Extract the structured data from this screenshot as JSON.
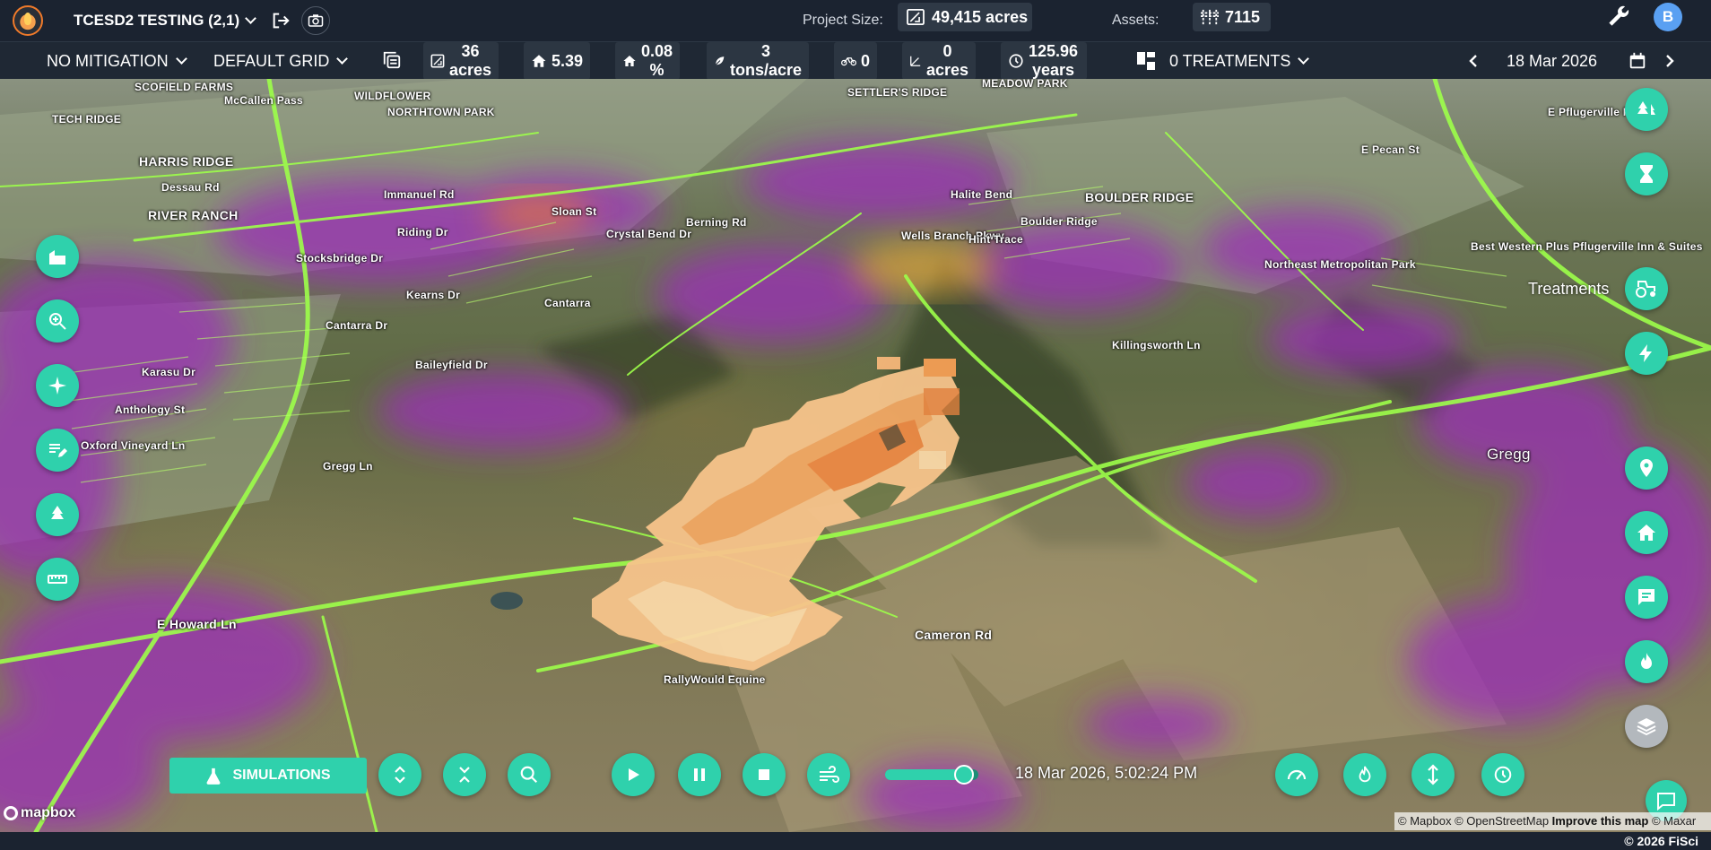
{
  "header": {
    "project_name": "TCESD2 TESTING (2,1)",
    "project_size_label": "Project Size:",
    "project_size_value": "49,415 acres",
    "assets_label": "Assets:",
    "assets_value": "7115",
    "user_initial": "B"
  },
  "toolbar": {
    "mitigation": "NO MITIGATION",
    "grid": "DEFAULT GRID",
    "stats": {
      "acres_value": "36",
      "acres_unit": "acres",
      "flame_height": "5.39",
      "percent_value": "0.08",
      "percent_unit": "%",
      "fuel_value": "3",
      "fuel_unit": "tons/acre",
      "bikes": "0",
      "slope_value": "0",
      "slope_unit": "acres",
      "years_value": "125.96",
      "years_unit": "years"
    },
    "treatments": "0 TREATMENTS",
    "date": "18 Mar 2026"
  },
  "map": {
    "labels": [
      "SCOFIELD FARMS",
      "TECH RIDGE",
      "McCallen Pass",
      "WILDFLOWER",
      "NORTHTOWN PARK",
      "HARRIS RIDGE",
      "Dessau Rd",
      "RIVER RANCH",
      "Immanuel Rd",
      "Riding Dr",
      "Stocksbridge Dr",
      "Sloan St",
      "Crystal Bend Dr",
      "Berning Rd",
      "Cantarra Dr",
      "Kearns Dr",
      "Cantarra",
      "E Howard Ln",
      "Baileyfield Dr",
      "Karasu Dr",
      "Anthology St",
      "Oxford Vineyard Ln",
      "Gregg Ln",
      "Wells Branch Pkwy",
      "Killingsworth Ln",
      "SETTLER'S RIDGE",
      "MEADOW PARK",
      "BOULDER RIDGE",
      "Boulder Ridge",
      "Hint Trace",
      "Halite Bend",
      "Northeast Metropolitan Park",
      "Best Western Plus Pflugerville Inn & Suites",
      "E Pecan St",
      "Cameron Rd",
      "RallyWould Equine",
      "Gregg",
      "E Pflugerville Pkwy"
    ],
    "treatments_label": "Treatments"
  },
  "controls": {
    "simulations_label": "SIMULATIONS",
    "sim_time": "18 Mar 2026, 5:02:24 PM",
    "playback_progress": 0.85
  },
  "footer": {
    "mapbox": "mapbox",
    "attribution_mapbox": "© Mapbox",
    "attribution_osm": "© OpenStreetMap",
    "attribution_improve": "Improve this map",
    "attribution_maxar": "© Maxar",
    "copyright": "© 2026 FiSci"
  },
  "colors": {
    "accent": "#2fd1ac",
    "topbar": "#1b2330",
    "fire_orange": "#f6a055",
    "risk_purple": "#9b2fb8",
    "roads": "#9dff4a"
  }
}
